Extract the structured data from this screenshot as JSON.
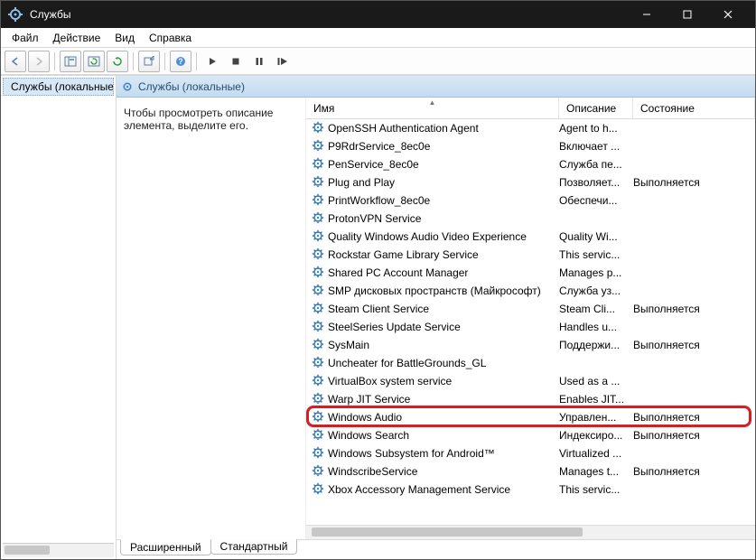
{
  "window": {
    "title": "Службы"
  },
  "menu": {
    "file": "Файл",
    "action": "Действие",
    "view": "Вид",
    "help": "Справка"
  },
  "tree": {
    "root": "Службы (локальные)"
  },
  "rightHeader": "Службы (локальные)",
  "description": "Чтобы просмотреть описание элемента, выделите его.",
  "columns": {
    "name": "Имя",
    "desc": "Описание",
    "state": "Состояние"
  },
  "tabs": {
    "extended": "Расширенный",
    "standard": "Стандартный"
  },
  "services": [
    {
      "name": "OpenSSH Authentication Agent",
      "desc": "Agent to h...",
      "state": ""
    },
    {
      "name": "P9RdrService_8ec0e",
      "desc": "Включает ...",
      "state": ""
    },
    {
      "name": "PenService_8ec0e",
      "desc": "Служба пе...",
      "state": ""
    },
    {
      "name": "Plug and Play",
      "desc": "Позволяет...",
      "state": "Выполняется"
    },
    {
      "name": "PrintWorkflow_8ec0e",
      "desc": "Обеспечи...",
      "state": ""
    },
    {
      "name": "ProtonVPN Service",
      "desc": "",
      "state": ""
    },
    {
      "name": "Quality Windows Audio Video Experience",
      "desc": "Quality Wi...",
      "state": ""
    },
    {
      "name": "Rockstar Game Library Service",
      "desc": "This servic...",
      "state": ""
    },
    {
      "name": "Shared PC Account Manager",
      "desc": "Manages p...",
      "state": ""
    },
    {
      "name": "SMP дисковых пространств (Майкрософт)",
      "desc": "Служба уз...",
      "state": ""
    },
    {
      "name": "Steam Client Service",
      "desc": "Steam Cli...",
      "state": "Выполняется"
    },
    {
      "name": "SteelSeries Update Service",
      "desc": "Handles u...",
      "state": ""
    },
    {
      "name": "SysMain",
      "desc": "Поддержи...",
      "state": "Выполняется"
    },
    {
      "name": "Uncheater for BattleGrounds_GL",
      "desc": "",
      "state": ""
    },
    {
      "name": "VirtualBox system service",
      "desc": "Used as a ...",
      "state": ""
    },
    {
      "name": "Warp JIT Service",
      "desc": "Enables JIT...",
      "state": ""
    },
    {
      "name": "Windows Audio",
      "desc": "Управлен...",
      "state": "Выполняется"
    },
    {
      "name": "Windows Search",
      "desc": "Индексиро...",
      "state": "Выполняется"
    },
    {
      "name": "Windows Subsystem for Android™",
      "desc": "Virtualized ...",
      "state": ""
    },
    {
      "name": "WindscribeService",
      "desc": "Manages t...",
      "state": "Выполняется"
    },
    {
      "name": "Xbox Accessory Management Service",
      "desc": "This servic...",
      "state": ""
    }
  ],
  "highlightIndex": 16
}
